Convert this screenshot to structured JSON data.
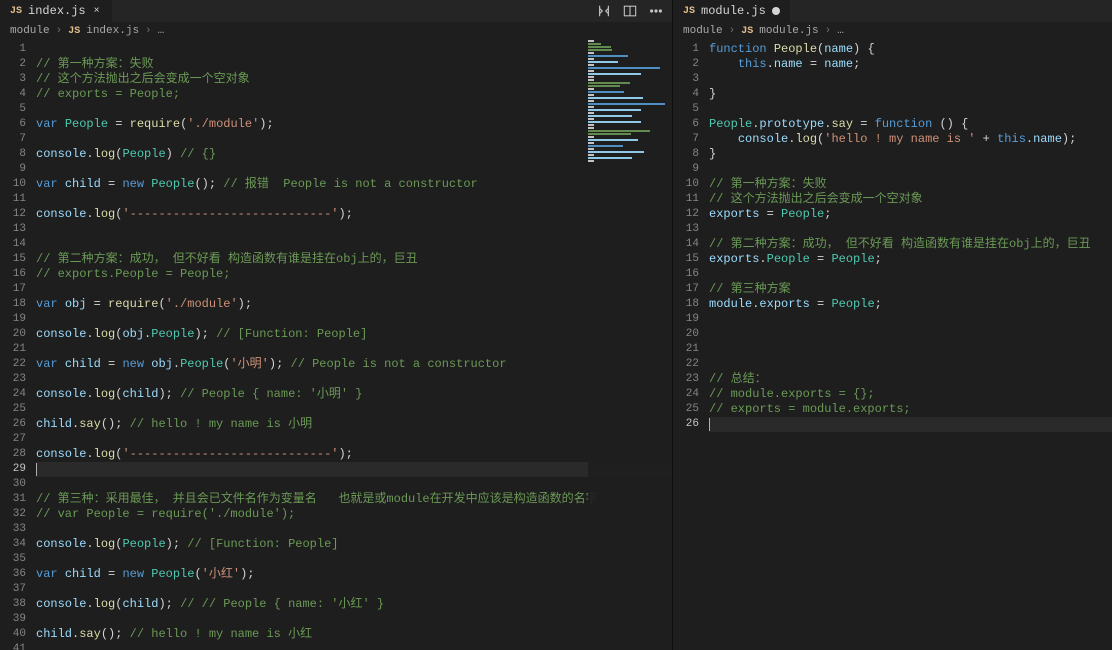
{
  "toolbar": {
    "icons": [
      "compare-icon",
      "layout-icon",
      "more-icon"
    ]
  },
  "left": {
    "tab": {
      "icon": "JS",
      "label": "index.js"
    },
    "breadcrumb": {
      "root": "module",
      "icon": "JS",
      "file": "index.js",
      "tail": "…"
    },
    "lines": [
      [
        " "
      ],
      [
        {
          "t": "// 第一种方案：失败",
          "c": "c"
        }
      ],
      [
        {
          "t": "// 这个方法抛出之后会变成一个空对象",
          "c": "c"
        }
      ],
      [
        {
          "t": "// exports = People;",
          "c": "c"
        }
      ],
      [
        " "
      ],
      [
        {
          "t": "var",
          "c": "k"
        },
        {
          "t": " "
        },
        {
          "t": "People",
          "c": "cl"
        },
        {
          "t": " = "
        },
        {
          "t": "require",
          "c": "fn"
        },
        {
          "t": "("
        },
        {
          "t": "'./module'",
          "c": "s"
        },
        {
          "t": ");"
        }
      ],
      [
        " "
      ],
      [
        {
          "t": "console",
          "c": "v"
        },
        {
          "t": "."
        },
        {
          "t": "log",
          "c": "fn"
        },
        {
          "t": "("
        },
        {
          "t": "People",
          "c": "cl"
        },
        {
          "t": ") "
        },
        {
          "t": "// {}",
          "c": "c"
        }
      ],
      [
        " "
      ],
      [
        {
          "t": "var",
          "c": "k"
        },
        {
          "t": " "
        },
        {
          "t": "child",
          "c": "v"
        },
        {
          "t": " = "
        },
        {
          "t": "new",
          "c": "k"
        },
        {
          "t": " "
        },
        {
          "t": "People",
          "c": "cl"
        },
        {
          "t": "(); "
        },
        {
          "t": "// 报错  People is not a constructor",
          "c": "c"
        }
      ],
      [
        " "
      ],
      [
        {
          "t": "console",
          "c": "v"
        },
        {
          "t": "."
        },
        {
          "t": "log",
          "c": "fn"
        },
        {
          "t": "("
        },
        {
          "t": "'----------------------------'",
          "c": "s"
        },
        {
          "t": ");"
        }
      ],
      [
        " "
      ],
      [
        " "
      ],
      [
        {
          "t": "// 第二种方案：成功， 但不好看 构造函数有谁是挂在obj上的，巨丑",
          "c": "c"
        }
      ],
      [
        {
          "t": "// exports.People = People;",
          "c": "c"
        }
      ],
      [
        " "
      ],
      [
        {
          "t": "var",
          "c": "k"
        },
        {
          "t": " "
        },
        {
          "t": "obj",
          "c": "v"
        },
        {
          "t": " = "
        },
        {
          "t": "require",
          "c": "fn"
        },
        {
          "t": "("
        },
        {
          "t": "'./module'",
          "c": "s"
        },
        {
          "t": ");"
        }
      ],
      [
        " "
      ],
      [
        {
          "t": "console",
          "c": "v"
        },
        {
          "t": "."
        },
        {
          "t": "log",
          "c": "fn"
        },
        {
          "t": "("
        },
        {
          "t": "obj",
          "c": "v"
        },
        {
          "t": "."
        },
        {
          "t": "People",
          "c": "cl"
        },
        {
          "t": "); "
        },
        {
          "t": "// [Function: People]",
          "c": "c"
        }
      ],
      [
        " "
      ],
      [
        {
          "t": "var",
          "c": "k"
        },
        {
          "t": " "
        },
        {
          "t": "child",
          "c": "v"
        },
        {
          "t": " = "
        },
        {
          "t": "new",
          "c": "k"
        },
        {
          "t": " "
        },
        {
          "t": "obj",
          "c": "v"
        },
        {
          "t": "."
        },
        {
          "t": "People",
          "c": "cl"
        },
        {
          "t": "("
        },
        {
          "t": "'小明'",
          "c": "s"
        },
        {
          "t": "); "
        },
        {
          "t": "// People is not a constructor",
          "c": "c"
        }
      ],
      [
        " "
      ],
      [
        {
          "t": "console",
          "c": "v"
        },
        {
          "t": "."
        },
        {
          "t": "log",
          "c": "fn"
        },
        {
          "t": "("
        },
        {
          "t": "child",
          "c": "v"
        },
        {
          "t": "); "
        },
        {
          "t": "// People { name: '小明' }",
          "c": "c"
        }
      ],
      [
        " "
      ],
      [
        {
          "t": "child",
          "c": "v"
        },
        {
          "t": "."
        },
        {
          "t": "say",
          "c": "fn"
        },
        {
          "t": "(); "
        },
        {
          "t": "// hello ! my name is 小明",
          "c": "c"
        }
      ],
      [
        " "
      ],
      [
        {
          "t": "console",
          "c": "v"
        },
        {
          "t": "."
        },
        {
          "t": "log",
          "c": "fn"
        },
        {
          "t": "("
        },
        {
          "t": "'----------------------------'",
          "c": "s"
        },
        {
          "t": ");"
        }
      ],
      [
        " "
      ],
      [
        " "
      ],
      [
        {
          "t": "// 第三种：采用最佳， 并且会已文件名作为变量名   也就是或module在开发中应该是构造函数的名字",
          "c": "c"
        }
      ],
      [
        {
          "t": "// var People = require('./module');",
          "c": "c"
        }
      ],
      [
        " "
      ],
      [
        {
          "t": "console",
          "c": "v"
        },
        {
          "t": "."
        },
        {
          "t": "log",
          "c": "fn"
        },
        {
          "t": "("
        },
        {
          "t": "People",
          "c": "cl"
        },
        {
          "t": "); "
        },
        {
          "t": "// [Function: People]",
          "c": "c"
        }
      ],
      [
        " "
      ],
      [
        {
          "t": "var",
          "c": "k"
        },
        {
          "t": " "
        },
        {
          "t": "child",
          "c": "v"
        },
        {
          "t": " = "
        },
        {
          "t": "new",
          "c": "k"
        },
        {
          "t": " "
        },
        {
          "t": "People",
          "c": "cl"
        },
        {
          "t": "("
        },
        {
          "t": "'小红'",
          "c": "s"
        },
        {
          "t": ");"
        }
      ],
      [
        " "
      ],
      [
        {
          "t": "console",
          "c": "v"
        },
        {
          "t": "."
        },
        {
          "t": "log",
          "c": "fn"
        },
        {
          "t": "("
        },
        {
          "t": "child",
          "c": "v"
        },
        {
          "t": "); "
        },
        {
          "t": "// // People { name: '小红' }",
          "c": "c"
        }
      ],
      [
        " "
      ],
      [
        {
          "t": "child",
          "c": "v"
        },
        {
          "t": "."
        },
        {
          "t": "say",
          "c": "fn"
        },
        {
          "t": "(); "
        },
        {
          "t": "// hello ! my name is 小红",
          "c": "c"
        }
      ],
      [
        " "
      ]
    ],
    "currentLine": 29
  },
  "right": {
    "tab": {
      "icon": "JS",
      "label": "module.js",
      "dirty": true
    },
    "breadcrumb": {
      "root": "module",
      "icon": "JS",
      "file": "module.js",
      "tail": "…"
    },
    "errorLine": 5,
    "lines": [
      [
        {
          "t": "function",
          "c": "k"
        },
        {
          "t": " "
        },
        {
          "t": "People",
          "c": "fn"
        },
        {
          "t": "("
        },
        {
          "t": "name",
          "c": "v"
        },
        {
          "t": ") {"
        }
      ],
      [
        {
          "t": "    "
        },
        {
          "t": "this",
          "c": "k"
        },
        {
          "t": "."
        },
        {
          "t": "name",
          "c": "v"
        },
        {
          "t": " = "
        },
        {
          "t": "name",
          "c": "v"
        },
        {
          "t": ";"
        }
      ],
      [
        " "
      ],
      [
        {
          "t": "}"
        }
      ],
      [
        " "
      ],
      [
        {
          "t": "People",
          "c": "cl"
        },
        {
          "t": "."
        },
        {
          "t": "prototype",
          "c": "v"
        },
        {
          "t": "."
        },
        {
          "t": "say",
          "c": "fn"
        },
        {
          "t": " = "
        },
        {
          "t": "function",
          "c": "k"
        },
        {
          "t": " () {"
        }
      ],
      [
        {
          "t": "    "
        },
        {
          "t": "console",
          "c": "v"
        },
        {
          "t": "."
        },
        {
          "t": "log",
          "c": "fn"
        },
        {
          "t": "("
        },
        {
          "t": "'hello ! my name is '",
          "c": "s"
        },
        {
          "t": " + "
        },
        {
          "t": "this",
          "c": "k"
        },
        {
          "t": "."
        },
        {
          "t": "name",
          "c": "v"
        },
        {
          "t": ");"
        }
      ],
      [
        {
          "t": "}"
        }
      ],
      [
        " "
      ],
      [
        {
          "t": "// 第一种方案：失败",
          "c": "c"
        }
      ],
      [
        {
          "t": "// 这个方法抛出之后会变成一个空对象",
          "c": "c"
        }
      ],
      [
        {
          "t": "exports",
          "c": "v"
        },
        {
          "t": " = "
        },
        {
          "t": "People",
          "c": "cl"
        },
        {
          "t": ";"
        }
      ],
      [
        " "
      ],
      [
        {
          "t": "// 第二种方案：成功， 但不好看 构造函数有谁是挂在obj上的，巨丑",
          "c": "c"
        }
      ],
      [
        {
          "t": "exports",
          "c": "v"
        },
        {
          "t": "."
        },
        {
          "t": "People",
          "c": "cl"
        },
        {
          "t": " = "
        },
        {
          "t": "People",
          "c": "cl"
        },
        {
          "t": ";"
        }
      ],
      [
        " "
      ],
      [
        {
          "t": "// 第三种方案",
          "c": "c"
        }
      ],
      [
        {
          "t": "module",
          "c": "v"
        },
        {
          "t": "."
        },
        {
          "t": "exports",
          "c": "v"
        },
        {
          "t": " = "
        },
        {
          "t": "People",
          "c": "cl"
        },
        {
          "t": ";"
        }
      ],
      [
        " "
      ],
      [
        " "
      ],
      [
        " "
      ],
      [
        " "
      ],
      [
        {
          "t": "// 总结：",
          "c": "c"
        }
      ],
      [
        {
          "t": "// module.exports = {};",
          "c": "c"
        }
      ],
      [
        {
          "t": "// exports = module.exports;",
          "c": "c"
        }
      ],
      [
        " "
      ]
    ],
    "currentLine": 26
  }
}
